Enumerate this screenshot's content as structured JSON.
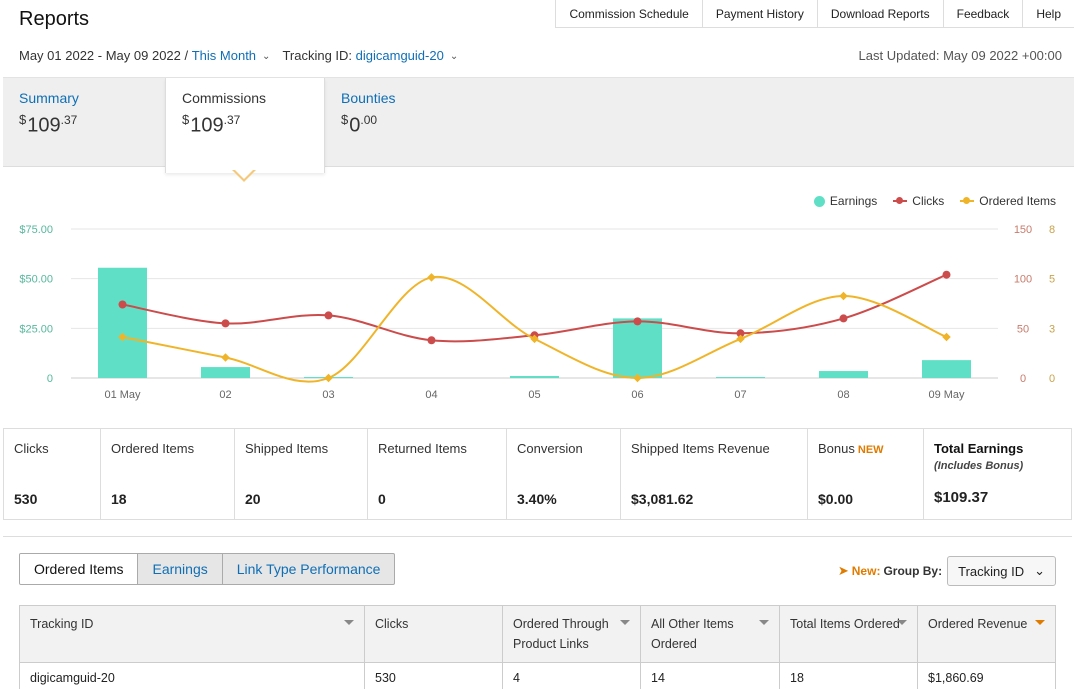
{
  "header": {
    "title": "Reports",
    "nav": [
      "Commission Schedule",
      "Payment History",
      "Download Reports",
      "Feedback",
      "Help"
    ]
  },
  "filters": {
    "date_range": "May 01 2022 - May 09 2022 /",
    "period": "This Month",
    "tracking_label": "Tracking ID:",
    "tracking_value": "digicamguid-20",
    "last_updated": "Last Updated: May 09 2022 +00:00"
  },
  "summary_tabs": [
    {
      "label": "Summary",
      "currency": "$",
      "whole": "109",
      "cents": ".37"
    },
    {
      "label": "Commissions",
      "currency": "$",
      "whole": "109",
      "cents": ".37"
    },
    {
      "label": "Bounties",
      "currency": "$",
      "whole": "0",
      "cents": ".00"
    }
  ],
  "legend": {
    "earnings": "Earnings",
    "clicks": "Clicks",
    "ordered": "Ordered Items"
  },
  "colors": {
    "earnings": "#5fe0c6",
    "clicks": "#cc4b4b",
    "ordered": "#f0b429",
    "link": "#0f6fb6",
    "accent": "#e07b00"
  },
  "chart_data": {
    "type": "bar",
    "categories": [
      "01 May",
      "02",
      "03",
      "04",
      "05",
      "06",
      "07",
      "08",
      "09 May"
    ],
    "series": [
      {
        "name": "Earnings",
        "type": "bar",
        "axis": "left",
        "values": [
          55.5,
          5.5,
          0.5,
          0,
          1,
          30,
          0.5,
          3.5,
          9
        ]
      },
      {
        "name": "Clicks",
        "type": "line",
        "axis": "right1",
        "values": [
          74,
          55,
          63,
          38,
          43,
          57,
          45,
          60,
          104
        ]
      },
      {
        "name": "Ordered Items",
        "type": "line",
        "axis": "right2",
        "values": [
          2.2,
          1.1,
          0,
          5.4,
          2.1,
          0,
          2.1,
          4.4,
          2.2
        ]
      }
    ],
    "y_left_ticks": [
      "0",
      "$25.00",
      "$50.00",
      "$75.00"
    ],
    "y_left_range": [
      0,
      75
    ],
    "y_right1_ticks": [
      "0",
      "50",
      "100",
      "150"
    ],
    "y_right1_range": [
      0,
      150
    ],
    "y_right2_ticks": [
      "0",
      "3",
      "5",
      "8"
    ],
    "y_right2_range": [
      0,
      8
    ],
    "grid": true,
    "legend_position": "top-right"
  },
  "metrics": [
    {
      "label": "Clicks",
      "value": "530"
    },
    {
      "label": "Ordered Items",
      "value": "18"
    },
    {
      "label": "Shipped Items",
      "value": "20"
    },
    {
      "label": "Returned Items",
      "value": "0"
    },
    {
      "label": "Conversion",
      "value": "3.40%"
    },
    {
      "label": "Shipped Items Revenue",
      "value": "$3,081.62"
    },
    {
      "label": "Bonus",
      "badge": "NEW",
      "value": "$0.00"
    },
    {
      "label": "Total Earnings",
      "sub": "(Includes Bonus)",
      "value": "$109.37"
    }
  ],
  "report_tabs": [
    "Ordered Items",
    "Earnings",
    "Link Type Performance"
  ],
  "group_by": {
    "new_label": "New:",
    "label": "Group By:",
    "value": "Tracking ID"
  },
  "table": {
    "headers": [
      "Tracking ID",
      "Clicks",
      "Ordered Through Product Links",
      "All Other Items Ordered",
      "Total Items Ordered",
      "Ordered Revenue"
    ],
    "rows": [
      [
        "digicamguid-20",
        "530",
        "4",
        "14",
        "18",
        "$1,860.69"
      ]
    ]
  }
}
